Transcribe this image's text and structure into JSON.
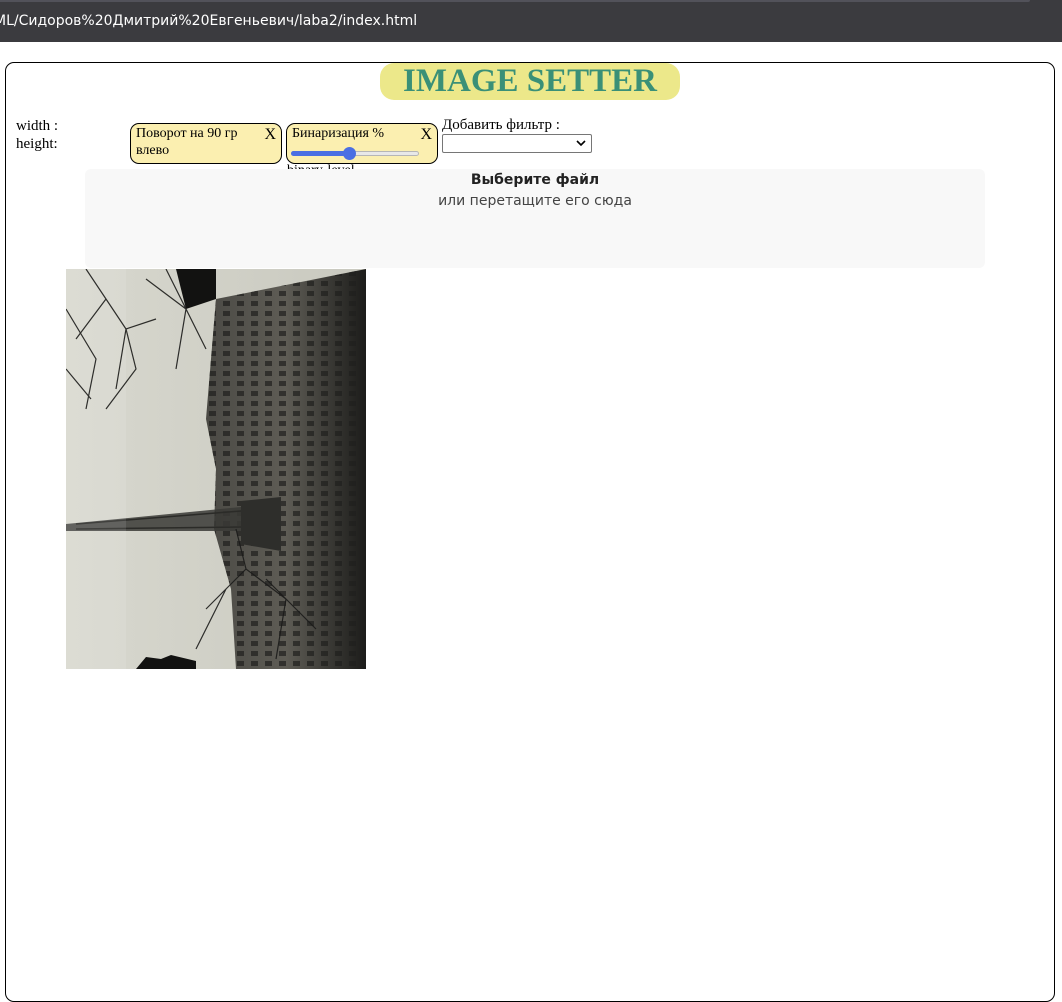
{
  "browser": {
    "address": "ML/Сидоров%20Дмитрий%20Евгеньевич/laba2/index.html"
  },
  "header": {
    "title": "IMAGE SETTER"
  },
  "dimensions": {
    "width_label": "width :",
    "height_label": "height:"
  },
  "filters": [
    {
      "label": "Поворот на 90 гр влево",
      "close": "X"
    },
    {
      "label": "Бинаризация %",
      "close": "X",
      "slider_value": 0.45,
      "slider_label": "binary-level"
    }
  ],
  "add_filter": {
    "label": "Добавить фильтр :",
    "selected": ""
  },
  "dropzone": {
    "title": "Выберите файл",
    "subtitle": "или перетащите его сюда"
  },
  "colors": {
    "title_bg": "#ece88a",
    "title_text": "#3a9077",
    "filter_bg": "#fbefb0",
    "slider_accent": "#4a6fe3"
  }
}
